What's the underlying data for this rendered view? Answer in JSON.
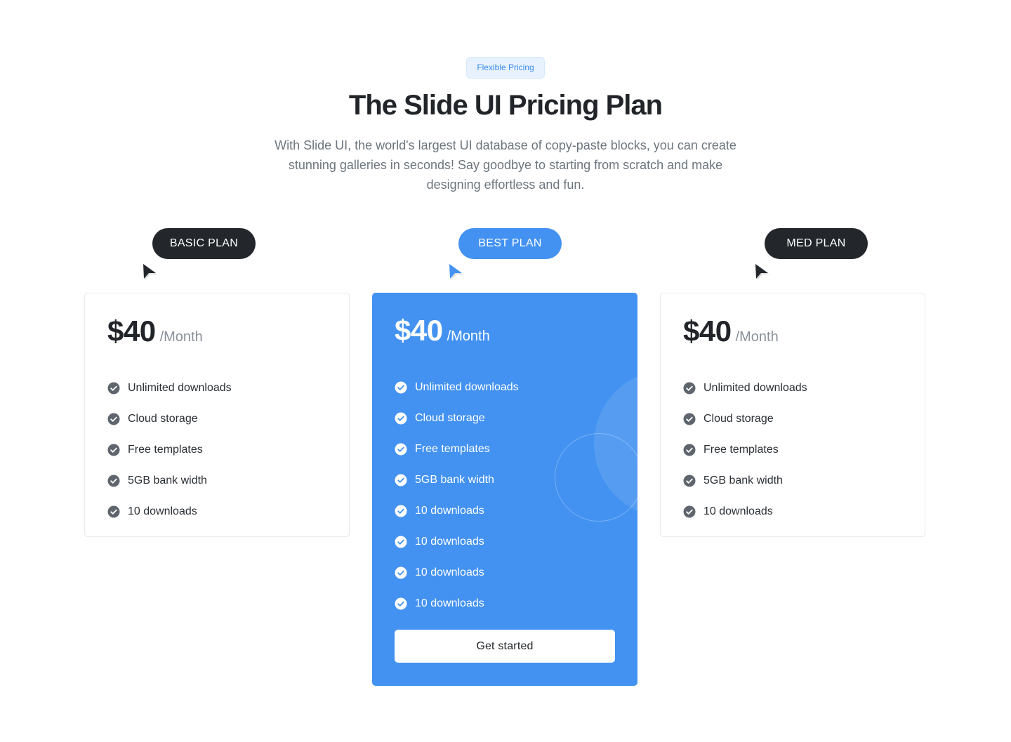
{
  "header": {
    "badge": "Flexible Pricing",
    "title": "The Slide UI Pricing Plan",
    "subtitle": "With Slide UI, the world's largest UI database of copy-paste blocks, you can create stunning galleries in seconds! Say goodbye to starting from scratch and make designing effortless and fun."
  },
  "colors": {
    "accent": "#4392f1",
    "dark": "#23272b",
    "badge_bg": "#e8f2fe"
  },
  "plans": [
    {
      "label": "BASIC PLAN",
      "price": "$40",
      "period": "/Month",
      "features": [
        "Unlimited downloads",
        "Cloud storage",
        "Free templates",
        "5GB bank width",
        "10 downloads"
      ]
    },
    {
      "label": "BEST PLAN",
      "price": "$40",
      "period": "/Month",
      "features": [
        "Unlimited downloads",
        "Cloud storage",
        "Free templates",
        "5GB bank width",
        "10 downloads",
        "10 downloads",
        "10 downloads",
        "10 downloads"
      ],
      "cta": "Get started"
    },
    {
      "label": "MED PLAN",
      "price": "$40",
      "period": "/Month",
      "features": [
        "Unlimited downloads",
        "Cloud storage",
        "Free templates",
        "5GB bank width",
        "10 downloads"
      ]
    }
  ],
  "icons": {
    "feature": "check-circle-icon",
    "pointer": "cursor-arrow-icon"
  }
}
